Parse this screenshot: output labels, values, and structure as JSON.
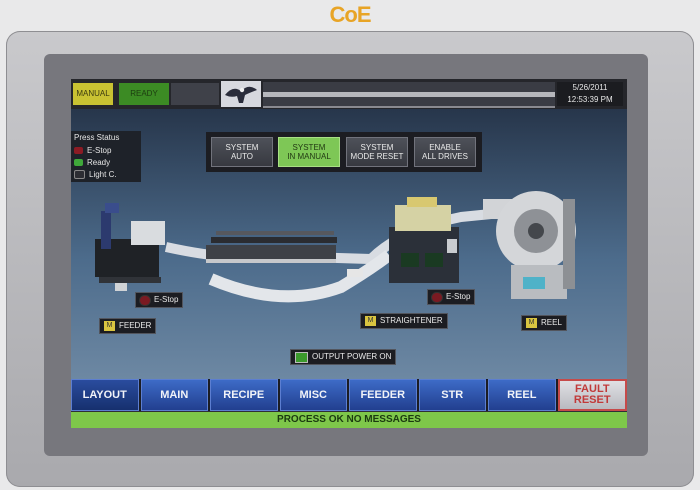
{
  "brand": {
    "logo": "CoE"
  },
  "topbar": {
    "mode_manual": "MANUAL",
    "mode_ready": "READY",
    "date": "5/26/2011",
    "time": "12:53:39 PM"
  },
  "press_status": {
    "title": "Press Status",
    "items": [
      {
        "label": "E-Stop",
        "color": "#8b1b24"
      },
      {
        "label": "Ready",
        "color": "#3fa83a"
      },
      {
        "label": "Light C.",
        "color": "#2c2d33"
      }
    ]
  },
  "system_buttons": [
    {
      "label_line1": "SYSTEM",
      "label_line2": "AUTO",
      "active": false
    },
    {
      "label_line1": "SYSTEM",
      "label_line2": "IN MANUAL",
      "active": true
    },
    {
      "label_line1": "SYSTEM",
      "label_line2": "MODE RESET",
      "active": false
    },
    {
      "label_line1": "ENABLE",
      "label_line2": "ALL DRIVES",
      "active": false
    }
  ],
  "machine_labels": {
    "feeder_estop": "E-Stop",
    "feeder": "FEEDER",
    "straightener": "STRAIGHTENER",
    "straightener_estop": "E-Stop",
    "reel": "REEL",
    "output_power": "OUTPUT POWER ON",
    "badge_letter": "M"
  },
  "nav": {
    "layout": "LAYOUT",
    "main": "MAIN",
    "recipe": "RECIPE",
    "misc": "MISC",
    "feeder": "FEEDER",
    "str": "STR",
    "reel": "REEL",
    "fault_line1": "FAULT",
    "fault_line2": "RESET"
  },
  "status_message": "PROCESS OK NO MESSAGES",
  "colors": {
    "accent_green": "#7ec74a",
    "nav_blue": "#2f57b3",
    "brand_orange": "#e8a426"
  }
}
